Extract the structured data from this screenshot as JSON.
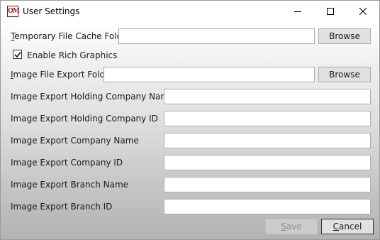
{
  "window": {
    "title": "User Settings",
    "icon_text": "OM",
    "icons": {
      "app": "om-app-icon",
      "minimize": "minimize-icon",
      "maximize": "maximize-icon",
      "close": "close-icon"
    }
  },
  "settings": {
    "temp_cache": {
      "label_accel": "T",
      "label_rest": "emporary File Cache Folder",
      "value": "",
      "browse_label": "Browse"
    },
    "rich_graphics": {
      "checked": true,
      "label": "Enable Rich Graphics"
    },
    "image_export_folder": {
      "label_accel": "I",
      "label_rest": "mage File Export Folder",
      "value": "",
      "browse_label": "Browse"
    },
    "holding_company_name": {
      "label": "Image Export Holding Company Name",
      "value": ""
    },
    "holding_company_id": {
      "label": "Image Export Holding Company ID",
      "value": ""
    },
    "company_name": {
      "label": "Image Export Company Name",
      "value": ""
    },
    "company_id": {
      "label": "Image Export Company ID",
      "value": ""
    },
    "branch_name": {
      "label": "Image Export Branch Name",
      "value": ""
    },
    "branch_id": {
      "label": "Image Export Branch ID",
      "value": ""
    }
  },
  "actions": {
    "save": {
      "accel": "S",
      "rest": "ave",
      "enabled": false
    },
    "cancel": {
      "accel": "C",
      "rest": "ancel"
    }
  }
}
